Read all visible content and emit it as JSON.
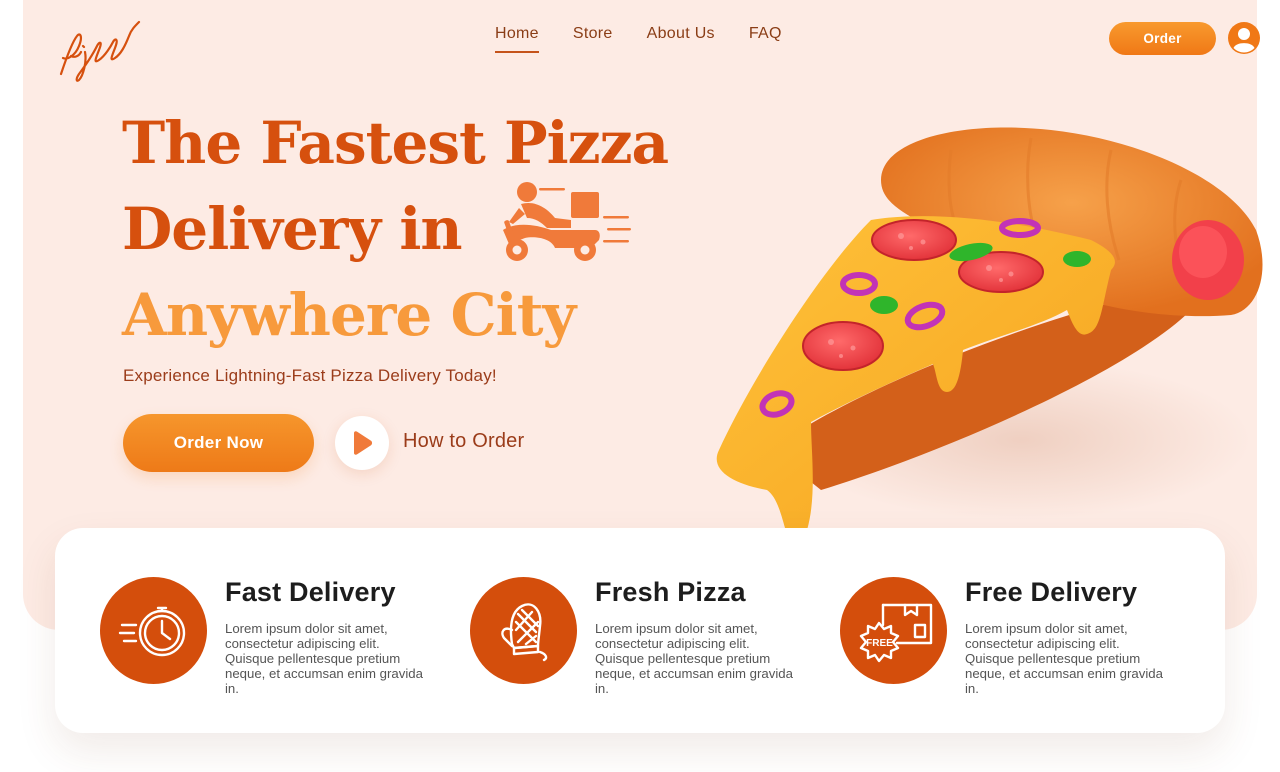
{
  "brand": {
    "logo_text": "Pizza"
  },
  "nav": {
    "items": [
      {
        "label": "Home",
        "active": true
      },
      {
        "label": "Store",
        "active": false
      },
      {
        "label": "About Us",
        "active": false
      },
      {
        "label": "FAQ",
        "active": false
      }
    ]
  },
  "header": {
    "order_label": "Order"
  },
  "hero": {
    "headline_line1": "The Fastest Pizza",
    "headline_line2": "Delivery in",
    "headline_line3": "Anywhere City",
    "subtitle": "Experience Lightning-Fast Pizza Delivery Today!",
    "order_now_label": "Order Now",
    "how_to_label": "How to Order"
  },
  "features": [
    {
      "title": "Fast Delivery",
      "description": "Lorem ipsum dolor sit amet, consectetur adipiscing elit. Quisque pellentesque pretium neque, et accumsan enim gravida in.",
      "icon": "stopwatch-icon"
    },
    {
      "title": "Fresh Pizza",
      "description": "Lorem ipsum dolor sit amet, consectetur adipiscing elit. Quisque pellentesque pretium neque, et accumsan enim gravida in.",
      "icon": "oven-mitt-icon"
    },
    {
      "title": "Free Delivery",
      "description": "Lorem ipsum dolor sit amet, consectetur adipiscing elit. Quisque pellentesque pretium neque, et accumsan enim gravida in.",
      "icon": "free-box-icon",
      "icon_badge_text": "FREE"
    }
  ],
  "colors": {
    "accent": "#f07816",
    "brand_dark": "#d6500e",
    "headline_light": "#f79a3c",
    "hero_bg": "#fdebe4",
    "text_brown": "#9b3c1a"
  }
}
